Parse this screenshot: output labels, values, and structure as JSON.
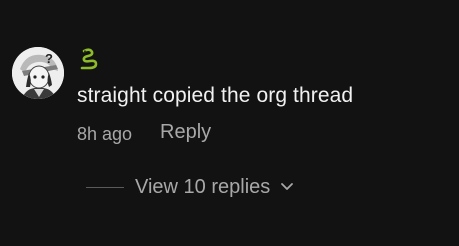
{
  "comment": {
    "username_icon": "snake-emoji-icon",
    "text": "straight copied the org thread",
    "timestamp": "8h ago",
    "reply_label": "Reply",
    "view_replies_label": "View 10 replies",
    "avatar": "avatar-image"
  },
  "colors": {
    "background": "#121212",
    "primary_text": "#f1f1f1",
    "secondary_text": "#a8a8a8",
    "snake_icon": "#8dbb2a"
  }
}
